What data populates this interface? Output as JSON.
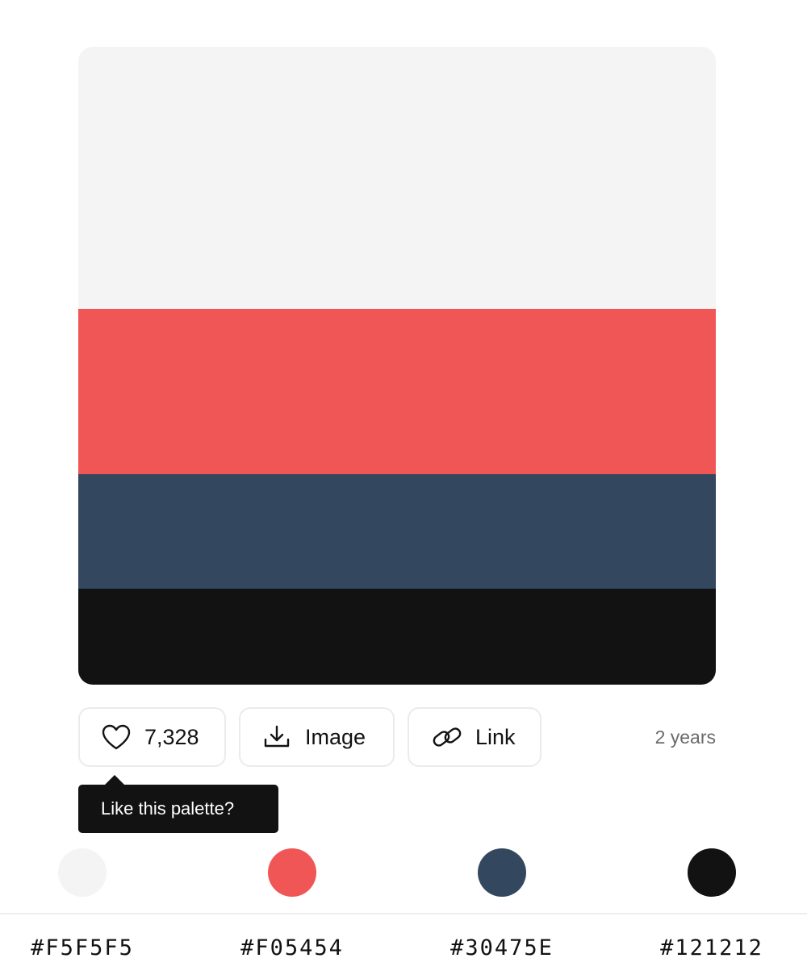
{
  "palette": {
    "colors": [
      {
        "hex": "#F5F5F5",
        "fill": "#f4f4f4",
        "share": 0.411
      },
      {
        "hex": "#F05454",
        "fill": "#f05656",
        "share": 0.259
      },
      {
        "hex": "#30475E",
        "fill": "#33485f",
        "share": 0.18
      },
      {
        "hex": "#121212",
        "fill": "#121212",
        "share": 0.15
      }
    ]
  },
  "actions": {
    "like_count": "7,328",
    "image_label": "Image",
    "link_label": "Link",
    "age": "2 years"
  },
  "tooltip": {
    "text": "Like this palette?"
  },
  "icons": {
    "like": "heart-icon",
    "image": "download-icon",
    "link": "link-icon"
  }
}
